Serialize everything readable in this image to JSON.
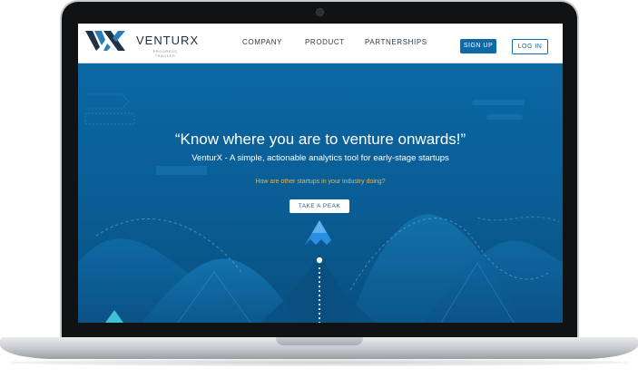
{
  "brand": {
    "name": "VENTURX",
    "subtitle": "PROGRESS TRACKER",
    "logo_text": "VX",
    "color": "#0d6aa7"
  },
  "nav": {
    "items": [
      "COMPANY",
      "PRODUCT",
      "PARTNERSHIPS"
    ],
    "signup_label": "SIGN UP",
    "login_label": "LOG IN"
  },
  "hero": {
    "quote": "“Know where you are to venture onwards!”",
    "tagline": "VenturX - A simple, actionable analytics tool for early-stage startups",
    "question": "How are other startups in your industry doing?",
    "cta_label": "TAKE A PEAK",
    "question_color": "#e3b45a",
    "background_color": "#0b67a3"
  },
  "icons": [
    "camera-icon",
    "logo-icon",
    "peak-icon",
    "progress-dot-icon"
  ]
}
